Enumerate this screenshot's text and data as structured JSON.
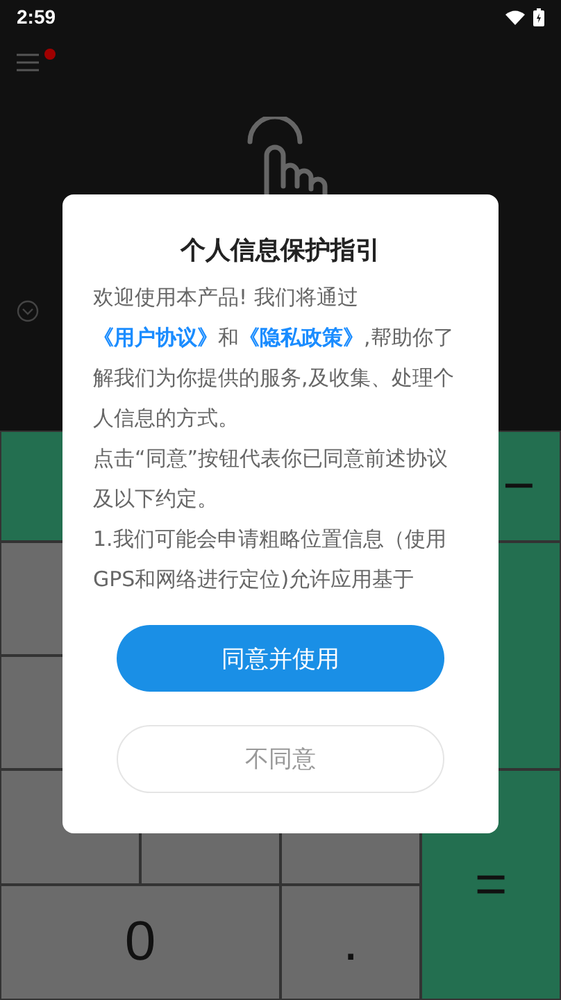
{
  "status_bar": {
    "time": "2:59"
  },
  "menu": {
    "has_notification": true
  },
  "keypad": {
    "minus": "−",
    "zero": "0",
    "point": ".",
    "equals": "="
  },
  "dialog": {
    "title": "个人信息保护指引",
    "intro": [
      {
        "kind": "text",
        "text": "欢迎使用本产品! 我们将通过"
      },
      {
        "kind": "link",
        "text": "《用户协议》"
      },
      {
        "kind": "text",
        "text": "和"
      },
      {
        "kind": "link",
        "text": "《隐私政策》"
      },
      {
        "kind": "text",
        "text": ",帮助你了解我们为你提供的服务,及收集、处理个人信息的方式。"
      }
    ],
    "paragraphs": [
      "点击“同意”按钮代表你已同意前述协议及以下约定。",
      "1.我们可能会申请粗略位置信息（使用GPS和网络进行定位)允许应用基于"
    ],
    "agree_button": "同意并使用",
    "disagree_button": "不同意"
  }
}
